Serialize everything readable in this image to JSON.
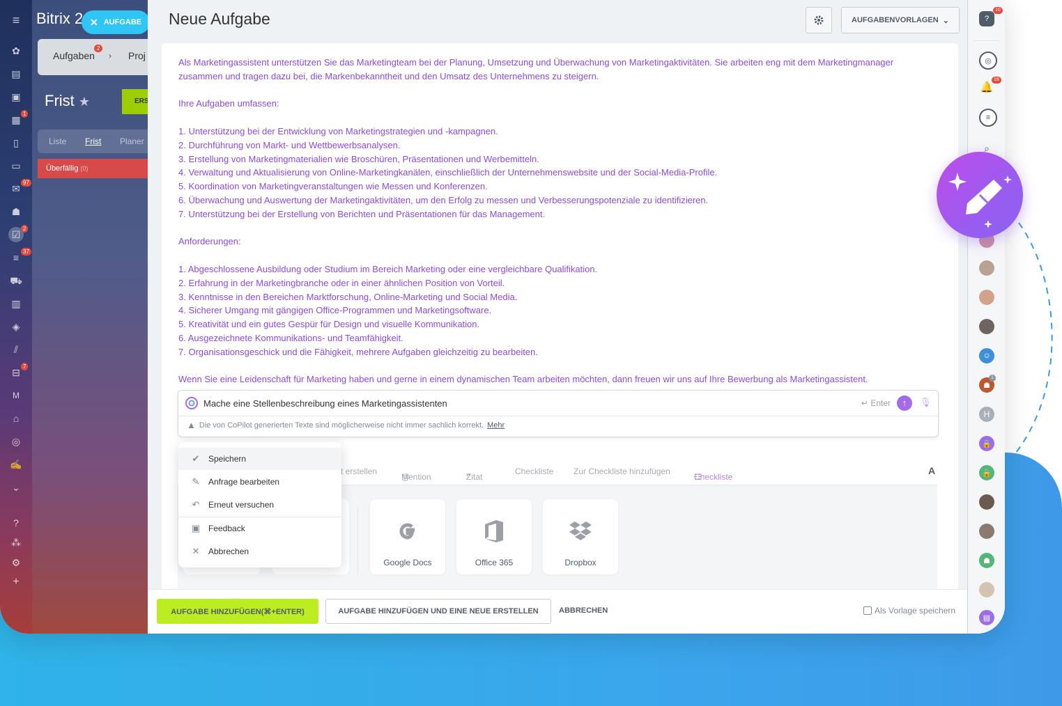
{
  "app": {
    "brand": "Bitrix",
    "brand_suffix": "2",
    "new_task_pill": "AUFGABE",
    "tabs": [
      "Aufgaben",
      "Proj"
    ],
    "tabs_badge": "2",
    "page_heading": "Frist",
    "create_button": "ERS",
    "view_tabs": [
      "Liste",
      "Frist",
      "Planer"
    ],
    "overdue_label": "Überfällig",
    "overdue_count": "(0)"
  },
  "left_rail": {
    "icons": [
      "grid-icon",
      "inbox-icon",
      "chat-icon",
      "calendar-icon",
      "document-icon",
      "drive-icon",
      "mail-icon",
      "groups-icon",
      "tasks-icon",
      "crm-funnel-icon",
      "cart-icon",
      "contact-card-icon",
      "box-icon",
      "marketing-icon",
      "inventory-icon",
      "m-letter-icon",
      "bank-icon",
      "target-icon",
      "sign-icon",
      "chevron-down-icon",
      "help-icon",
      "sitemap-icon",
      "settings-icon",
      "plus-icon"
    ],
    "badges": {
      "calendar": "1",
      "mail": "97",
      "tasks": "2",
      "crm": "37",
      "inventory": "7"
    },
    "m_letter": "M"
  },
  "panel": {
    "title": "Neue Aufgabe",
    "templates_button": "AUFGABENVORLAGEN"
  },
  "ai_text": [
    "Als Marketingassistent unterstützen Sie das Marketingteam bei der Planung, Umsetzung und Überwachung von Marketingaktivitäten. Sie arbeiten eng mit dem Marketingmanager zusammen und tragen dazu bei, die Markenbekanntheit und den Umsatz des Unternehmens zu steigern.",
    "",
    "Ihre Aufgaben umfassen:",
    "",
    "1. Unterstützung bei der Entwicklung von Marketingstrategien und -kampagnen.",
    "2. Durchführung von Markt- und Wettbewerbsanalysen.",
    "3. Erstellung von Marketingmaterialien wie Broschüren, Präsentationen und Werbemitteln.",
    "4. Verwaltung und Aktualisierung von Online-Marketingkanälen, einschließlich der Unternehmenswebsite und der Social-Media-Profile.",
    "5. Koordination von Marketingveranstaltungen wie Messen und Konferenzen.",
    "6. Überwachung und Auswertung der Marketingaktivitäten, um den Erfolg zu messen und Verbesserungspotenziale zu identifizieren.",
    "7. Unterstützung bei der Erstellung von Berichten und Präsentationen für das Management.",
    "",
    "Anforderungen:",
    "",
    "1. Abgeschlossene Ausbildung oder Studium im Bereich Marketing oder eine vergleichbare Qualifikation.",
    "2. Erfahrung in der Marketingbranche oder in einer ähnlichen Position von Vorteil.",
    "3. Kenntnisse in den Bereichen Marktforschung, Online-Marketing und Social Media.",
    "4. Sicherer Umgang mit gängigen Office-Programmen und Marketingsoftware.",
    "5. Kreativität und ein gutes Gespür für Design und visuelle Kommunikation.",
    "6. Ausgezeichnete Kommunikations- und Teamfähigkeit.",
    "7. Organisationsgeschick und die Fähigkeit, mehrere Aufgaben gleichzeitig zu bearbeiten.",
    "",
    "Wenn Sie eine Leidenschaft für Marketing haben und gerne in einem dynamischen Team arbeiten möchten, dann freuen wir uns auf Ihre Bewerbung als Marketingassistent."
  ],
  "prompt": {
    "value": "Mache eine Stellenbeschreibung eines Marketingassistenten",
    "enter_hint": "Enter",
    "warning": "Die von CoPilot generierten Texte sind möglicherweise nicht immer sachlich korrekt.",
    "more_link": "Mehr"
  },
  "toolbar": {
    "items": [
      "t erstellen",
      "Mention",
      "Zitat",
      "Checkliste",
      "Zur Checkliste hinzufügen",
      "Checkliste"
    ],
    "font_button": "A"
  },
  "attachments": [
    {
      "label": "Google Docs",
      "icon": "google-docs-icon"
    },
    {
      "label": "Office 365",
      "icon": "office-365-icon"
    },
    {
      "label": "Dropbox",
      "icon": "dropbox-icon"
    }
  ],
  "menu": {
    "items": [
      {
        "label": "Speichern",
        "icon": "check-icon"
      },
      {
        "label": "Anfrage bearbeiten",
        "icon": "pencil-icon"
      },
      {
        "label": "Erneut versuchen",
        "icon": "undo-icon"
      },
      {
        "label": "Feedback",
        "icon": "feedback-icon"
      },
      {
        "label": "Abbrechen",
        "icon": "close-icon"
      }
    ]
  },
  "footer": {
    "add_button": "AUFGABE HINZUFÜGEN(⌘+ENTER)",
    "add_new_button": "AUFGABE HINZUFÜGEN UND EINE NEUE ERSTELLEN",
    "cancel_button": "ABBRECHEN",
    "save_template": "Als Vorlage speichern"
  },
  "right_rail": {
    "help_badge": "10",
    "notify_badge": "18",
    "group_badge": "1",
    "initial_avatar": "H"
  },
  "colors": {
    "ai_text": "#8f4ae0",
    "primary_green": "#bbed21",
    "accent_blue": "#2fc6f6",
    "copilot_purple": "#a36be8"
  }
}
